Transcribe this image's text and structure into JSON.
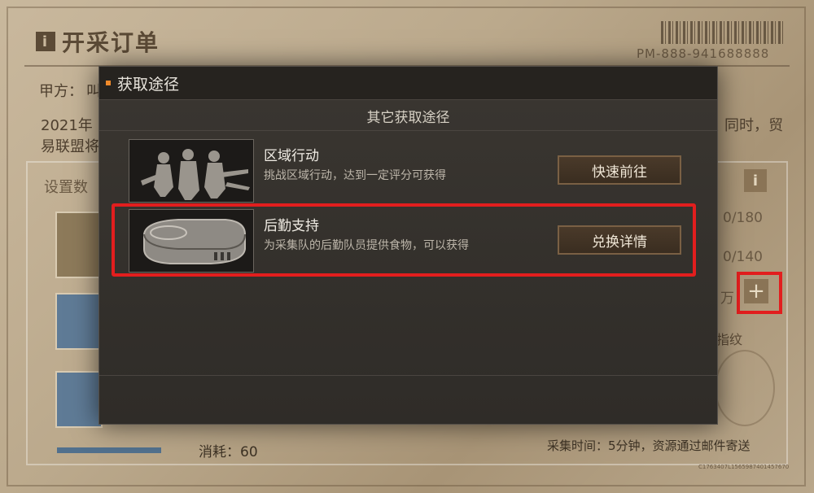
{
  "background": {
    "title": "开采订单",
    "info_glyph": "i",
    "order_no": "PM-888-941688888",
    "party_a_label": "甲方：",
    "party_a_value": "叫",
    "line1_left": "2021年",
    "line1_right": "同时，贸",
    "line2_left": "易联盟将",
    "settings_label": "设置数",
    "counter_1": "0/180",
    "counter_2": "0/140",
    "unit_wan": "万",
    "fingerprint_label": "指纹",
    "consume_label": "消耗：60",
    "collect_text": "采集时间：5分钟，资源通过邮件寄送",
    "tiny_code": "C1763407L1565987401457670",
    "plus_glyph": "+"
  },
  "modal": {
    "title": "获取途径",
    "subtitle": "其它获取途径",
    "routes": [
      {
        "name": "区域行动",
        "desc": "挑战区域行动，达到一定评分可获得",
        "button": "快速前往",
        "icon": "soldiers-icon"
      },
      {
        "name": "后勤支持",
        "desc": "为采集队的后勤队员提供食物，可以获得",
        "button": "兑换详情",
        "icon": "ration-can-icon"
      }
    ]
  },
  "colors": {
    "highlight": "#e21e1e",
    "accent": "#f08a2a"
  }
}
